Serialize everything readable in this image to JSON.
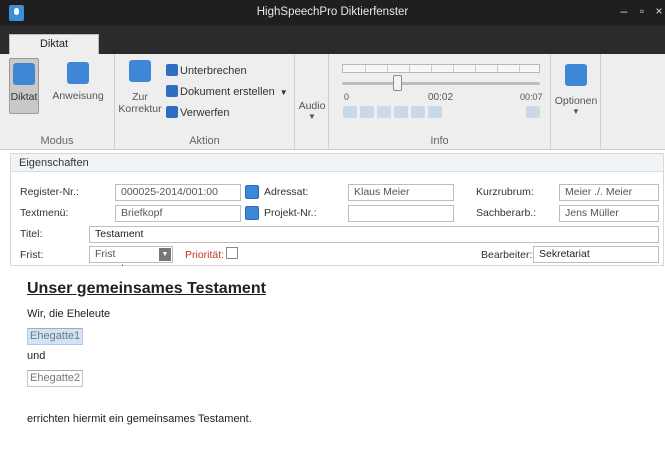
{
  "window": {
    "title": "HighSpeechPro Diktierfenster",
    "minimize": "–",
    "restore": "▫",
    "close": "×"
  },
  "tab": {
    "label": "Diktat"
  },
  "ribbon": {
    "modus": {
      "label": "Modus",
      "diktat": "Diktat",
      "anweisung": "Anweisung"
    },
    "aktion": {
      "label": "Aktion",
      "zur": "Zur",
      "korrektur": "Korrektur",
      "unterbrechen": "Unterbrechen",
      "dokument_erstellen": "Dokument erstellen",
      "verwerfen": "Verwerfen"
    },
    "audio": {
      "label": "Audio"
    },
    "info": {
      "label": "Info",
      "start": "0",
      "current": "00:02",
      "end": "00:07",
      "position_fraction": 0.28
    },
    "optionen": {
      "label": "Optionen"
    }
  },
  "properties": {
    "header": "Eigenschaften",
    "register_label": "Register-Nr.:",
    "register_value": "000025-2014/001:00",
    "adressat_label": "Adressat:",
    "adressat_value": "Klaus Meier",
    "kurzrubrum_label": "Kurzrubrum:",
    "kurzrubrum_value": "Meier ./. Meier",
    "textmenu_label": "Textmenü:",
    "textmenu_value": "Briefkopf",
    "projekt_label": "Projekt-Nr.:",
    "projekt_value": "",
    "sachbearb_label": "Sachberarb.:",
    "sachbearb_value": "Jens Müller",
    "titel_label": "Titel:",
    "titel_value": "Testament",
    "frist_label": "Frist:",
    "frist_value": "Frist vorgeben",
    "prioritaet_label": "Priorität:",
    "bearbeiter_label": "Bearbeiter:",
    "bearbeiter_value": "Sekretariat"
  },
  "document": {
    "heading": "Unser gemeinsames Testament",
    "line1": "Wir, die Eheleute",
    "ph1": "Ehegatte1",
    "und": "und",
    "ph2": "Ehegatte2",
    "line2": "errichten hiermit ein gemeinsames Testament."
  },
  "colors": {
    "accent": "#3f87d6",
    "titlebar": "#1f1f21",
    "priority": "#c0392b"
  }
}
